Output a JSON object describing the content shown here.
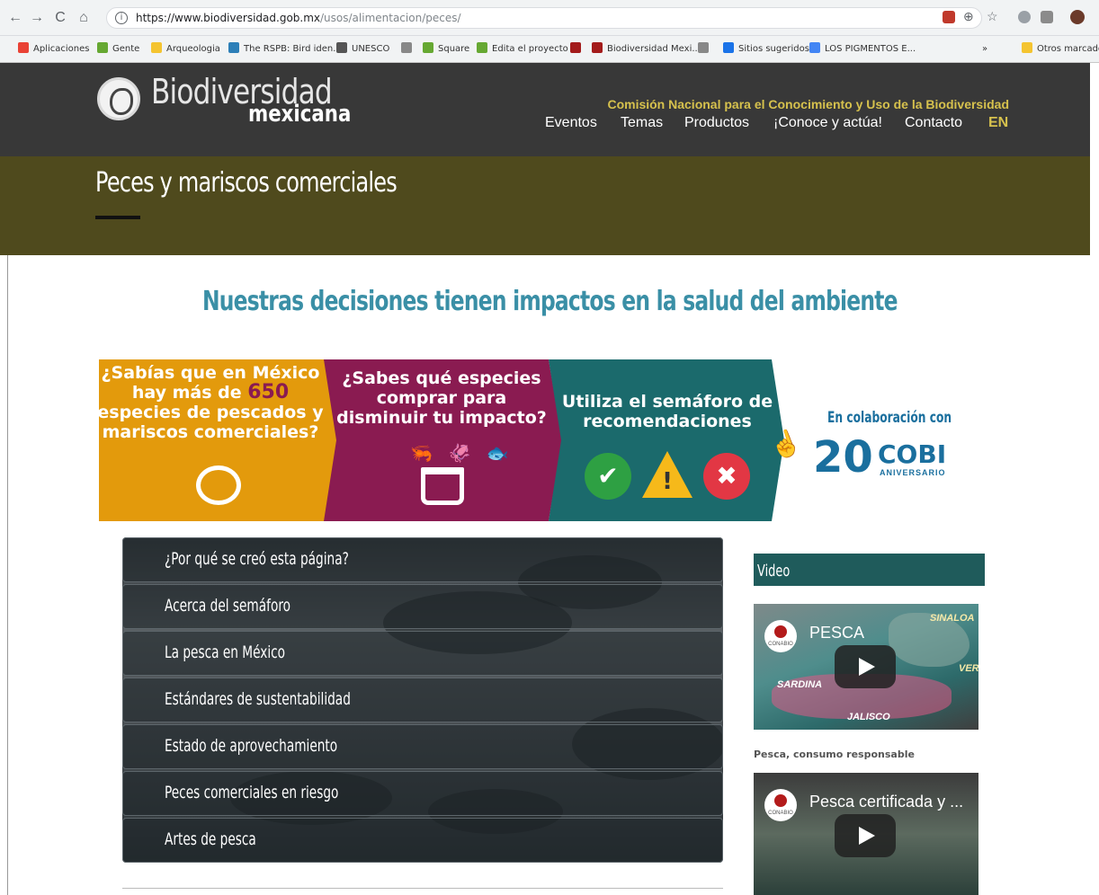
{
  "browser": {
    "url_host": "https://www.biodiversidad.gob.mx",
    "url_path": "/usos/alimentacion/peces/",
    "nav": {
      "back": "←",
      "forward": "→",
      "reload": "C",
      "home": "⌂"
    },
    "bookmarks": [
      {
        "label": "Aplicaciones",
        "color": "#e94235"
      },
      {
        "label": "Gente",
        "color": "#66a832"
      },
      {
        "label": "Arqueologia",
        "color": "#f4c430"
      },
      {
        "label": "The RSPB: Bird iden...",
        "color": "#2c7fb8"
      },
      {
        "label": "UNESCO",
        "color": "#555555"
      },
      {
        "label": "",
        "color": "#888888"
      },
      {
        "label": "Square",
        "color": "#66a832"
      },
      {
        "label": "Edita el proyecto",
        "color": "#66a832"
      },
      {
        "label": "",
        "color": "#a31b1b"
      },
      {
        "label": "Biodiversidad Mexi...",
        "color": "#a31b1b"
      },
      {
        "label": "",
        "color": "#888888"
      },
      {
        "label": "Sitios sugeridos",
        "color": "#1a73e8"
      },
      {
        "label": "LOS PIGMENTOS E...",
        "color": "#4285f4"
      }
    ],
    "bookmarks_more": "»",
    "other_bookmarks": "Otros marcadores"
  },
  "site": {
    "logo_main": "Biodiversidad",
    "logo_sub": "mexicana",
    "org_name": "Comisión Nacional para el Conocimiento y Uso de la Biodiversidad",
    "nav": [
      "Eventos",
      "Temas",
      "Productos",
      "¡Conoce y actúa!",
      "Contacto"
    ],
    "lang": "EN"
  },
  "banner": {
    "title": "Peces y mariscos comerciales"
  },
  "headline": "Nuestras decisiones tienen impactos en la salud del ambiente",
  "panels": {
    "p1_before": "¿Sabías que en México hay más de ",
    "p1_number": "650",
    "p1_after": " especies de pescados y mariscos comerciales?",
    "p2": "¿Sabes qué especies comprar para disminuir tu impacto?",
    "p3": "Utiliza el semáforo de recomendaciones",
    "sea_icons": "🦐 🦑 🐟",
    "light_ok": "✔",
    "light_warn": "!",
    "light_no": "✖"
  },
  "collab": {
    "label": "En colaboración con",
    "logo_number": "20",
    "logo_name": "COBI",
    "logo_sub": "ANIVERSARIO"
  },
  "menu": [
    "¿Por qué se creó esta página?",
    "Acerca del semáforo",
    "La pesca en México",
    "Estándares de sustentabilidad",
    "Estado de aprovechamiento",
    "Peces comerciales en riesgo",
    "Artes de pesca"
  ],
  "video": {
    "heading": "Video",
    "v1_title": "PESCA",
    "v1_caption": "Pesca, consumo responsable",
    "v1_tags": [
      "SINALOA",
      "SARDINA",
      "JALISCO",
      "VER"
    ],
    "v2_title": "Pesca certificada y ...",
    "channel": "CONABIO"
  }
}
